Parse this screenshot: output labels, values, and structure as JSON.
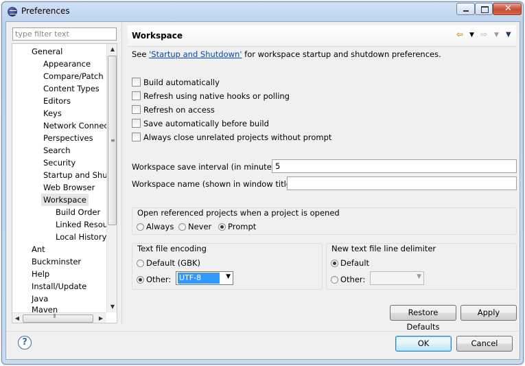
{
  "window": {
    "title": "Preferences"
  },
  "filter": {
    "placeholder": "type filter text"
  },
  "tree": {
    "items": [
      {
        "label": "General"
      },
      {
        "label": "Appearance"
      },
      {
        "label": "Compare/Patch"
      },
      {
        "label": "Content Types"
      },
      {
        "label": "Editors"
      },
      {
        "label": "Keys"
      },
      {
        "label": "Network Connectio"
      },
      {
        "label": "Perspectives"
      },
      {
        "label": "Search"
      },
      {
        "label": "Security"
      },
      {
        "label": "Startup and Shutd"
      },
      {
        "label": "Web Browser"
      },
      {
        "label": "Workspace"
      },
      {
        "label": "Build Order"
      },
      {
        "label": "Linked Resourc"
      },
      {
        "label": "Local History"
      },
      {
        "label": "Ant"
      },
      {
        "label": "Buckminster"
      },
      {
        "label": "Help"
      },
      {
        "label": "Install/Update"
      },
      {
        "label": "Java"
      },
      {
        "label": "Maven"
      }
    ]
  },
  "page": {
    "title": "Workspace",
    "see_prefix": "See ",
    "see_link": "'Startup and Shutdown'",
    "see_suffix": " for workspace startup and shutdown preferences.",
    "checkboxes": [
      {
        "label": "Build automatically",
        "checked": false
      },
      {
        "label": "Refresh using native hooks or polling",
        "checked": false
      },
      {
        "label": "Refresh on access",
        "checked": false
      },
      {
        "label": "Save automatically before build",
        "checked": false
      },
      {
        "label": "Always close unrelated projects without prompt",
        "checked": false
      }
    ],
    "save_interval": {
      "label": "Workspace save interval (in minutes):",
      "value": "5"
    },
    "workspace_name": {
      "label": "Workspace name (shown in window title):",
      "value": ""
    },
    "open_projects": {
      "title": "Open referenced projects when a project is opened",
      "options": [
        "Always",
        "Never",
        "Prompt"
      ],
      "selected": "Prompt"
    },
    "encoding": {
      "title": "Text file encoding",
      "default_label": "Default (GBK)",
      "other_label": "Other:",
      "other_value": "UTF-8",
      "selected": "Other"
    },
    "line_delimiter": {
      "title": "New text file line delimiter",
      "default_label": "Default",
      "other_label": "Other:",
      "selected": "Default"
    },
    "restore_defaults": "Restore Defaults",
    "apply": "Apply"
  },
  "dialog": {
    "ok": "OK",
    "cancel": "Cancel",
    "help_glyph": "?"
  },
  "icons": {
    "back": "back-arrow-icon",
    "forward": "forward-arrow-icon",
    "menu": "view-menu-icon"
  },
  "colors": {
    "link": "#0645ad",
    "selection": "#3399ff"
  }
}
